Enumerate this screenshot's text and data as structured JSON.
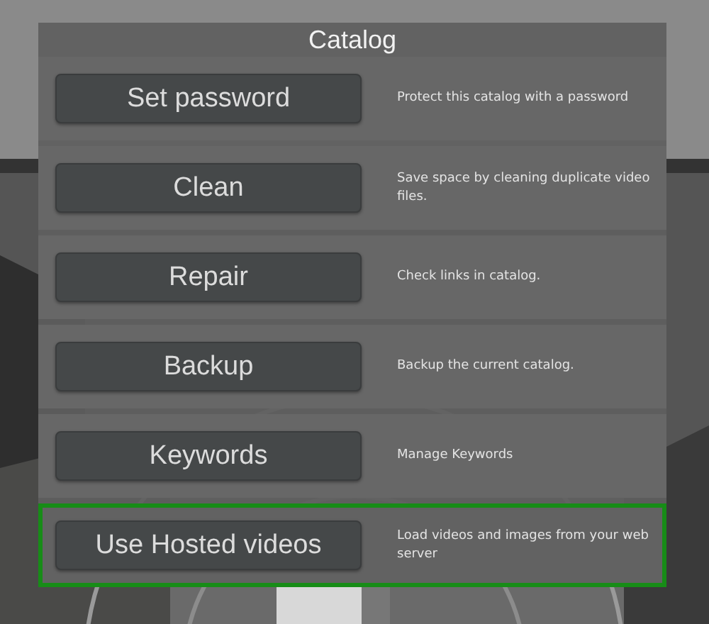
{
  "dialog": {
    "title": "Catalog"
  },
  "rows": [
    {
      "button": "Set password",
      "description": "Protect this catalog with a password",
      "highlighted": false
    },
    {
      "button": "Clean",
      "description": "Save space by cleaning duplicate video files.",
      "highlighted": false
    },
    {
      "button": "Repair",
      "description": "Check links in catalog.",
      "highlighted": false
    },
    {
      "button": "Backup",
      "description": "Backup the current catalog.",
      "highlighted": false
    },
    {
      "button": "Keywords",
      "description": "Manage Keywords",
      "highlighted": false
    },
    {
      "button": "Use Hosted videos",
      "description": "Load videos and images from your web server",
      "highlighted": true
    }
  ]
}
